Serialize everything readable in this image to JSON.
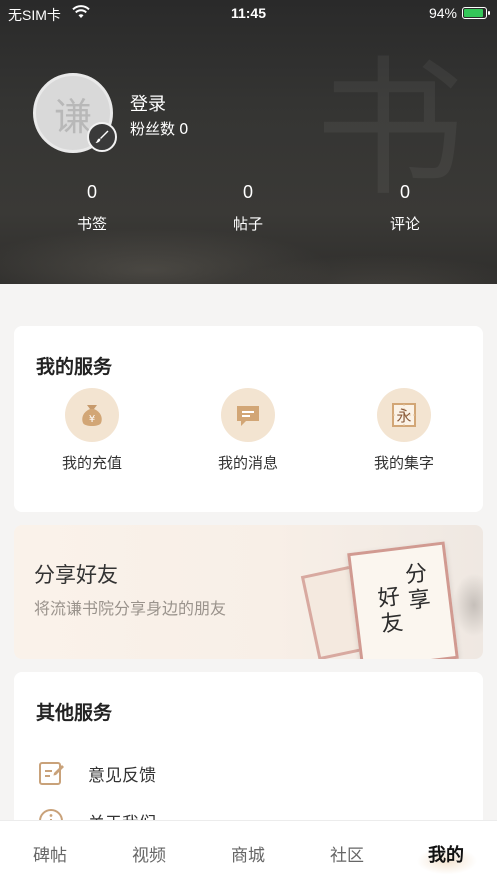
{
  "status_bar": {
    "carrier": "无SIM卡",
    "time": "11:45",
    "battery": "94%"
  },
  "profile": {
    "avatar_char": "谦",
    "login": "登录",
    "fans_label": "粉丝数",
    "fans_count": "0"
  },
  "stats": [
    {
      "value": "0",
      "label": "书签"
    },
    {
      "value": "0",
      "label": "帖子"
    },
    {
      "value": "0",
      "label": "评论"
    }
  ],
  "my_services": {
    "title": "我的服务",
    "items": [
      {
        "label": "我的充值",
        "icon": "money-bag-icon"
      },
      {
        "label": "我的消息",
        "icon": "message-icon"
      },
      {
        "label": "我的集字",
        "icon": "collect-character-icon"
      }
    ]
  },
  "share": {
    "title": "分享好友",
    "subtitle": "将流谦书院分享身边的朋友"
  },
  "other_services": {
    "title": "其他服务",
    "items": [
      {
        "label": "意见反馈",
        "icon": "feedback-icon"
      },
      {
        "label": "关于我们",
        "icon": "info-icon"
      }
    ]
  },
  "tabs": [
    {
      "label": "碑帖"
    },
    {
      "label": "视频"
    },
    {
      "label": "商城"
    },
    {
      "label": "社区"
    },
    {
      "label": "我的",
      "active": true
    }
  ],
  "colors": {
    "accent": "#c9a27a",
    "icon_bg": "#f3e4d1",
    "battery_green": "#34c759"
  }
}
